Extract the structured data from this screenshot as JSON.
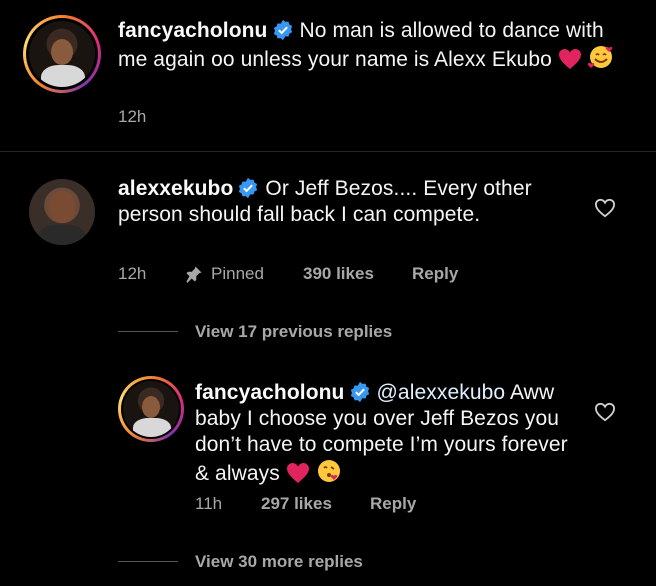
{
  "comments": [
    {
      "username": "fancyacholonu",
      "text": "No man is allowed to dance with me again oo unless your name is Alexx Ekubo",
      "time": "12h"
    },
    {
      "username": "alexxekubo",
      "text": "Or Jeff Bezos.... Every other person should fall back I can compete.",
      "time": "12h",
      "pinned_label": "Pinned",
      "likes": "390 likes",
      "reply_label": "Reply",
      "view_replies": "View 17 previous replies"
    },
    {
      "username": "fancyacholonu",
      "mention": "@alexxekubo",
      "text": "Aww baby I choose you over Jeff Bezos you don’t have to compete I’m yours forever & always",
      "time": "11h",
      "likes": "297 likes",
      "reply_label": "Reply"
    }
  ],
  "more_replies": "View 30 more replies",
  "colors": {
    "background": "#000000",
    "verified": "#3897f0",
    "meta": "#a8a8a8",
    "heart": "#e0245e"
  },
  "icons": [
    "verified-badge-icon",
    "heart-emoji-icon",
    "smiling-hearts-emoji-icon",
    "kissing-emoji-icon",
    "pin-icon",
    "like-heart-icon"
  ]
}
